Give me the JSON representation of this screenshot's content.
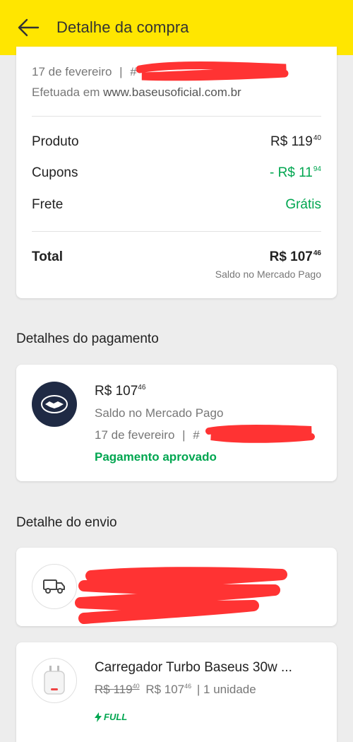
{
  "header": {
    "title": "Detalhe da compra"
  },
  "purchase": {
    "date": "17 de fevereiro",
    "separator": "|",
    "order_prefix": "#",
    "made_at_prefix": "Efetuada em ",
    "store": "www.baseusoficial.com.br"
  },
  "summary": {
    "product_label": "Produto",
    "product_int": "R$ 119",
    "product_dec": "40",
    "coupon_label": "Cupons",
    "coupon_int": "- R$ 11",
    "coupon_dec": "94",
    "shipping_label": "Frete",
    "shipping_value": "Grátis",
    "total_label": "Total",
    "total_int": "R$ 107",
    "total_dec": "46",
    "total_method": "Saldo no Mercado Pago"
  },
  "payment": {
    "section_title": "Detalhes do pagamento",
    "amount_int": "R$ 107",
    "amount_dec": "46",
    "method": "Saldo no Mercado Pago",
    "date": "17 de fevereiro",
    "separator": "|",
    "order_prefix": "#",
    "status": "Pagamento aprovado"
  },
  "shipping": {
    "section_title": "Detalhe do envio"
  },
  "product": {
    "title": "Carregador Turbo Baseus 30w ...",
    "old_int": "R$ 119",
    "old_dec": "40",
    "new_int": "R$ 107",
    "new_dec": "46",
    "quantity": "| 1 unidade",
    "badge": "FULL"
  },
  "colors": {
    "brand_yellow": "#ffe600",
    "success_green": "#00a650",
    "redaction_red": "#ff3333"
  },
  "icons": {
    "back": "arrow-left-icon",
    "payment": "mercado-pago-handshake-icon",
    "shipping": "truck-icon",
    "badge": "lightning-icon"
  }
}
